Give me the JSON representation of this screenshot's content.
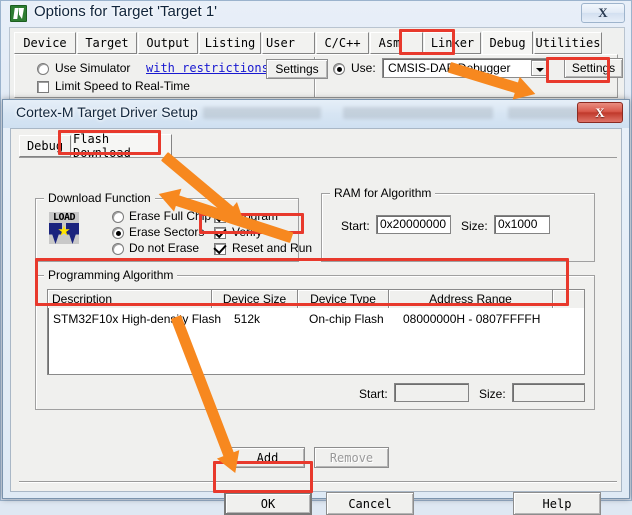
{
  "outer_window": {
    "title": "Options for Target 'Target 1'",
    "icon": "keil-uvision-icon",
    "close_label": "X",
    "tabs": [
      {
        "label": "Device",
        "active": false
      },
      {
        "label": "Target",
        "active": false
      },
      {
        "label": "Output",
        "active": false
      },
      {
        "label": "Listing",
        "active": false
      },
      {
        "label": "User",
        "active": false
      },
      {
        "label": "C/C++",
        "active": false
      },
      {
        "label": "Asm",
        "active": false
      },
      {
        "label": "Linker",
        "active": false
      },
      {
        "label": "Debug",
        "active": true
      },
      {
        "label": "Utilities",
        "active": false
      }
    ],
    "debug_tab": {
      "use_simulator_label": "Use Simulator",
      "use_simulator_selected": false,
      "with_restrictions_link": "with restrictions",
      "limit_speed_label": "Limit Speed to Real-Time",
      "limit_speed_checked": false,
      "simulator_settings_label": "Settings",
      "use_label": "Use:",
      "use_selected": true,
      "debugger_value": "CMSIS-DAP Debugger",
      "debugger_settings_label": "Settings"
    }
  },
  "inner_dialog": {
    "title": "Cortex-M Target Driver Setup",
    "close_label": "X",
    "tabs": [
      {
        "label": "Debug",
        "active": false
      },
      {
        "label": "Flash Download",
        "active": true
      }
    ],
    "download_function": {
      "title": "Download Function",
      "icon": "load-icon",
      "icon_text": "LOAD",
      "radios": [
        {
          "label": "Erase Full Chip",
          "selected": false
        },
        {
          "label": "Erase Sectors",
          "selected": true
        },
        {
          "label": "Do not Erase",
          "selected": false
        }
      ],
      "checkboxes": [
        {
          "label": "Program",
          "checked": true
        },
        {
          "label": "Verify",
          "checked": true
        },
        {
          "label": "Reset and Run",
          "checked": true
        }
      ]
    },
    "ram_for_algorithm": {
      "title": "RAM for Algorithm",
      "start_label": "Start:",
      "start_value": "0x20000000",
      "size_label": "Size:",
      "size_value": "0x1000"
    },
    "programming_algorithm": {
      "title": "Programming Algorithm",
      "columns": [
        "Description",
        "Device Size",
        "Device Type",
        "Address Range",
        ""
      ],
      "rows": [
        {
          "description": "STM32F10x High-density Flash",
          "device_size": "512k",
          "device_type": "On-chip Flash",
          "address_range": "08000000H - 0807FFFFH"
        }
      ],
      "start_label": "Start:",
      "start_value": "",
      "size_label": "Size:",
      "size_value": "",
      "add_label": "Add",
      "remove_label": "Remove",
      "remove_disabled": true
    },
    "footer": {
      "ok_label": "OK",
      "cancel_label": "Cancel",
      "help_label": "Help"
    }
  },
  "annotations": {
    "highlight_color": "#e8392c",
    "arrow_color": "#f7881f",
    "highlighted": [
      "Debug tab",
      "Settings button",
      "Flash Download tab",
      "Reset and Run checkbox",
      "Programming Algorithm table row",
      "OK button"
    ]
  }
}
